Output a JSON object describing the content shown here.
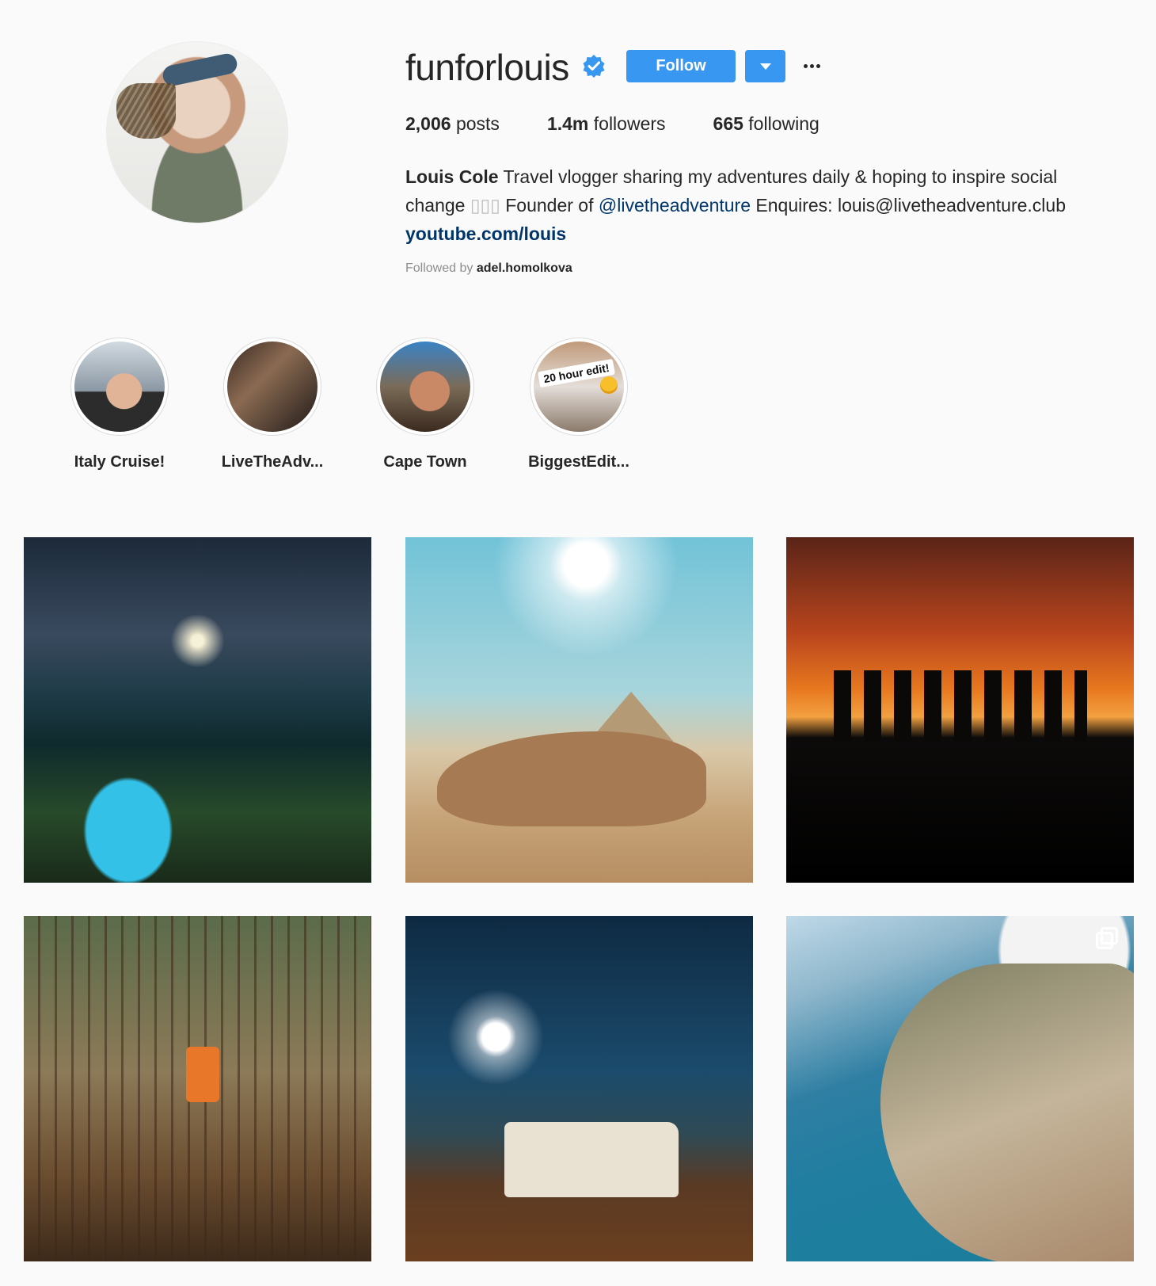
{
  "profile": {
    "username": "funforlouis",
    "follow_label": "Follow",
    "stats": {
      "posts_count": "2,006",
      "posts_label": "posts",
      "followers_count": "1.4m",
      "followers_label": "followers",
      "following_count": "665",
      "following_label": "following"
    },
    "bio": {
      "name": "Louis Cole",
      "text1": "Travel vlogger sharing my adventures daily & hoping to inspire social change",
      "glyphs": "▯▯▯",
      "text2": "Founder of",
      "mention": "@livetheadventure",
      "text3": "Enquires: louis@livetheadventure.club",
      "url": "youtube.com/louis"
    },
    "followed_by_label": "Followed by",
    "followed_by_user": "adel.homolkova"
  },
  "highlights": [
    {
      "label": "Italy Cruise!"
    },
    {
      "label": "LiveTheAdv..."
    },
    {
      "label": "Cape Town"
    },
    {
      "label": "BiggestEdit..."
    }
  ],
  "highlight_overlay": "20 hour edit!",
  "colors": {
    "accent": "#3897f0",
    "link": "#003569",
    "muted": "#8e8e8e",
    "text": "#262626"
  },
  "icons": [
    "verified-badge-icon",
    "dropdown-caret-icon",
    "more-options-icon",
    "multi-post-icon"
  ]
}
